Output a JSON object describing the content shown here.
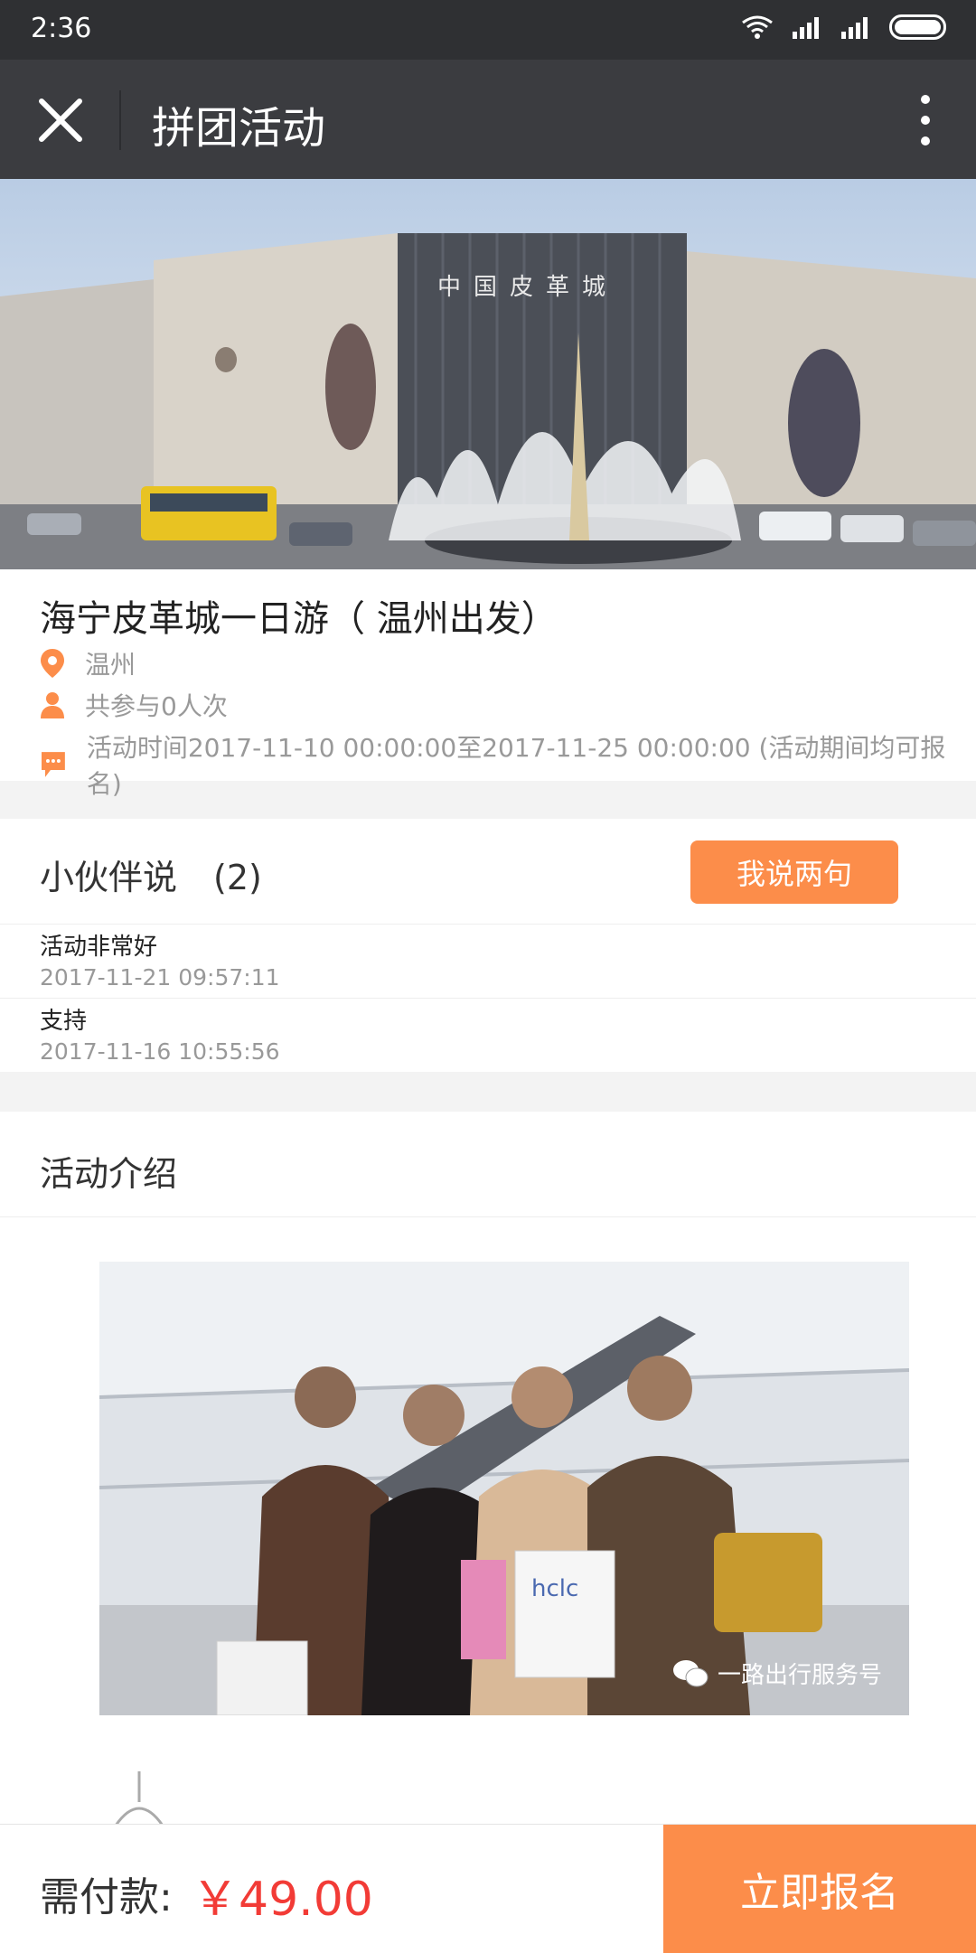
{
  "status_bar": {
    "time": "2:36"
  },
  "header": {
    "title": "拼团活动"
  },
  "activity": {
    "title": "海宁皮革城一日游（ 温州出发）",
    "location": "温州",
    "participants": "共参与0人次",
    "time_text": "活动时间2017-11-10 00:00:00至2017-11-25 00:00:00 (活动期间均可报名)"
  },
  "comments": {
    "heading": "小伙伴说",
    "count": "(2)",
    "button": "我说两句",
    "items": [
      {
        "text": "活动非常好",
        "time": "2017-11-21 09:57:11"
      },
      {
        "text": "支持",
        "time": "2017-11-16 10:55:56"
      }
    ]
  },
  "intro": {
    "heading": "活动介绍",
    "watermark": "一路出行服务号"
  },
  "hero_sign": "中国皮革城",
  "bag_brand": "hclc",
  "footer": {
    "price_label": "需付款:",
    "price": "￥49.00",
    "signup_button": "立即报名"
  },
  "colors": {
    "accent": "#fc8d4a",
    "price": "#f23b36",
    "titlebar": "#3b3c40",
    "statusbar": "#2f3033"
  }
}
